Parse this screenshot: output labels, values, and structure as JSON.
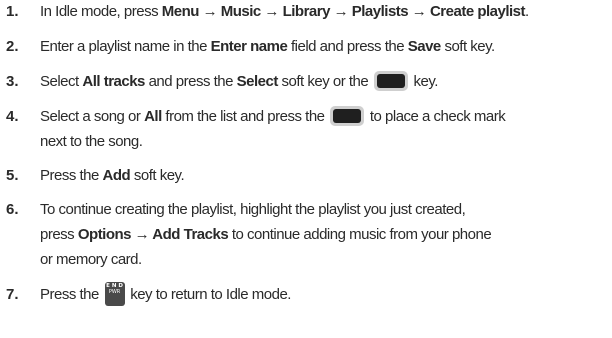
{
  "steps": [
    {
      "num": "1.",
      "t1": "In Idle mode, press ",
      "b1": "Menu → Music → Library → Playlists → Create playlist",
      "t2": "."
    },
    {
      "num": "2.",
      "t1": "Enter a playlist name in the ",
      "b1": "Enter name",
      "t2": " field and press the ",
      "b2": "Save",
      "t3": " soft key."
    },
    {
      "num": "3.",
      "t1": "Select ",
      "b1": "All tracks",
      "t2": " and press the ",
      "b2": "Select",
      "t3": " soft key or the ",
      "t4": " key."
    },
    {
      "num": "4.",
      "l1_t1": "Select a song or ",
      "l1_b1": "All",
      "l1_t2": " from the list and press the ",
      "l1_t3": " to place a check mark",
      "l2": "next to the song."
    },
    {
      "num": "5.",
      "t1": "Press the ",
      "b1": "Add",
      "t2": " soft key."
    },
    {
      "num": "6.",
      "l1": "To continue creating the playlist, highlight the playlist you just created,",
      "l2_t1": "press ",
      "l2_b1": "Options → Add Tracks",
      "l2_t2": " to continue adding music from your phone",
      "l3": "or memory card."
    },
    {
      "num": "7.",
      "t1": "Press the ",
      "t2": " key to return to Idle mode."
    }
  ],
  "keys": {
    "end_top": "E N D",
    "end_bottom": "PWR",
    "soft_key_color": "#1f1f1f",
    "end_key_color": "#4a4a4a"
  }
}
